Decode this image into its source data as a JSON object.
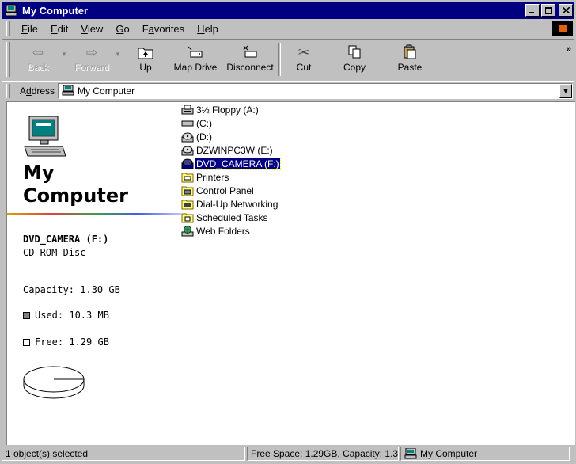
{
  "window": {
    "title": "My Computer",
    "controls": [
      "minimize",
      "maximize",
      "close"
    ]
  },
  "menu": {
    "items": [
      {
        "label": "File",
        "accel": "F"
      },
      {
        "label": "Edit",
        "accel": "E"
      },
      {
        "label": "View",
        "accel": "V"
      },
      {
        "label": "Go",
        "accel": "G"
      },
      {
        "label": "Favorites",
        "accel": "a"
      },
      {
        "label": "Help",
        "accel": "H"
      }
    ]
  },
  "toolbar": {
    "back": "Back",
    "forward": "Forward",
    "up": "Up",
    "map_drive": "Map Drive",
    "disconnect": "Disconnect",
    "cut": "Cut",
    "copy": "Copy",
    "paste": "Paste",
    "more": "»"
  },
  "address": {
    "label": "Address",
    "value": "My Computer"
  },
  "left_panel": {
    "heading_line1": "My",
    "heading_line2": "Computer",
    "selected_name": "DVD_CAMERA (F:)",
    "selected_type": "CD-ROM Disc",
    "capacity": "Capacity: 1.30 GB",
    "used": "Used: 10.3 MB",
    "free": "Free: 1.29 GB",
    "used_fraction": 0.008
  },
  "items": [
    {
      "label": "3½ Floppy (A:)",
      "icon": "floppy-drive-icon"
    },
    {
      "label": "(C:)",
      "icon": "hard-drive-icon"
    },
    {
      "label": "(D:)",
      "icon": "cd-drive-icon"
    },
    {
      "label": "DZWINPC3W (E:)",
      "icon": "cd-drive-icon"
    },
    {
      "label": "DVD_CAMERA (F:)",
      "icon": "dvd-drive-icon",
      "selected": true
    },
    {
      "label": "Printers",
      "icon": "printers-folder-icon"
    },
    {
      "label": "Control Panel",
      "icon": "control-panel-folder-icon"
    },
    {
      "label": "Dial-Up Networking",
      "icon": "dial-up-folder-icon"
    },
    {
      "label": "Scheduled Tasks",
      "icon": "scheduled-tasks-folder-icon"
    },
    {
      "label": "Web Folders",
      "icon": "web-folders-icon"
    }
  ],
  "status": {
    "selection": "1 object(s) selected",
    "space": "Free Space: 1.29GB,  Capacity: 1.3...",
    "location": "My Computer"
  },
  "colors": {
    "titlebar": "#000080",
    "selection": "#000080",
    "chrome": "#c0c0c0"
  }
}
